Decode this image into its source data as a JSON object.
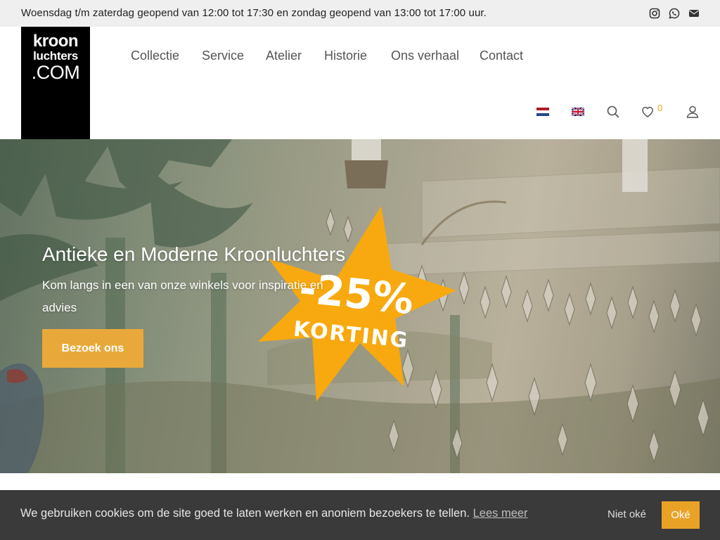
{
  "topbar": {
    "hours": "Woensdag t/m zaterdag geopend van 12:00 tot 17:30 en zondag geopend van 13:00 tot 17:00 uur.",
    "icons": [
      "instagram-icon",
      "whatsapp-icon",
      "mail-icon"
    ]
  },
  "logo": {
    "line1": "kroon",
    "line2": "luchters",
    "line3": ".COM"
  },
  "nav": [
    "Collectie",
    "Service",
    "Atelier",
    "Historie",
    "Ons verhaal",
    "Contact"
  ],
  "header_icons": {
    "languages": [
      "nl",
      "en"
    ],
    "wishlist_count": "0",
    "icons": [
      "search-icon",
      "heart-icon",
      "user-icon"
    ]
  },
  "hero": {
    "title": "Antieke en Moderne Kroonluchters",
    "subtitle": "Kom langs in een van onze winkels voor inspiratie en advies",
    "button": "Bezoek ons",
    "badge_percent": "-25%",
    "badge_text": "KORTING"
  },
  "cookie": {
    "text": "We gebruiken cookies om de site goed te laten werken en anoniem bezoekers te tellen.",
    "link": "Lees meer",
    "decline": "Niet oké",
    "accept": "Oké"
  },
  "colors": {
    "accent": "#e9a93a",
    "badge": "#f7a90f",
    "cookie_bg": "#3a3a3a",
    "topbar_bg": "#efefef"
  }
}
